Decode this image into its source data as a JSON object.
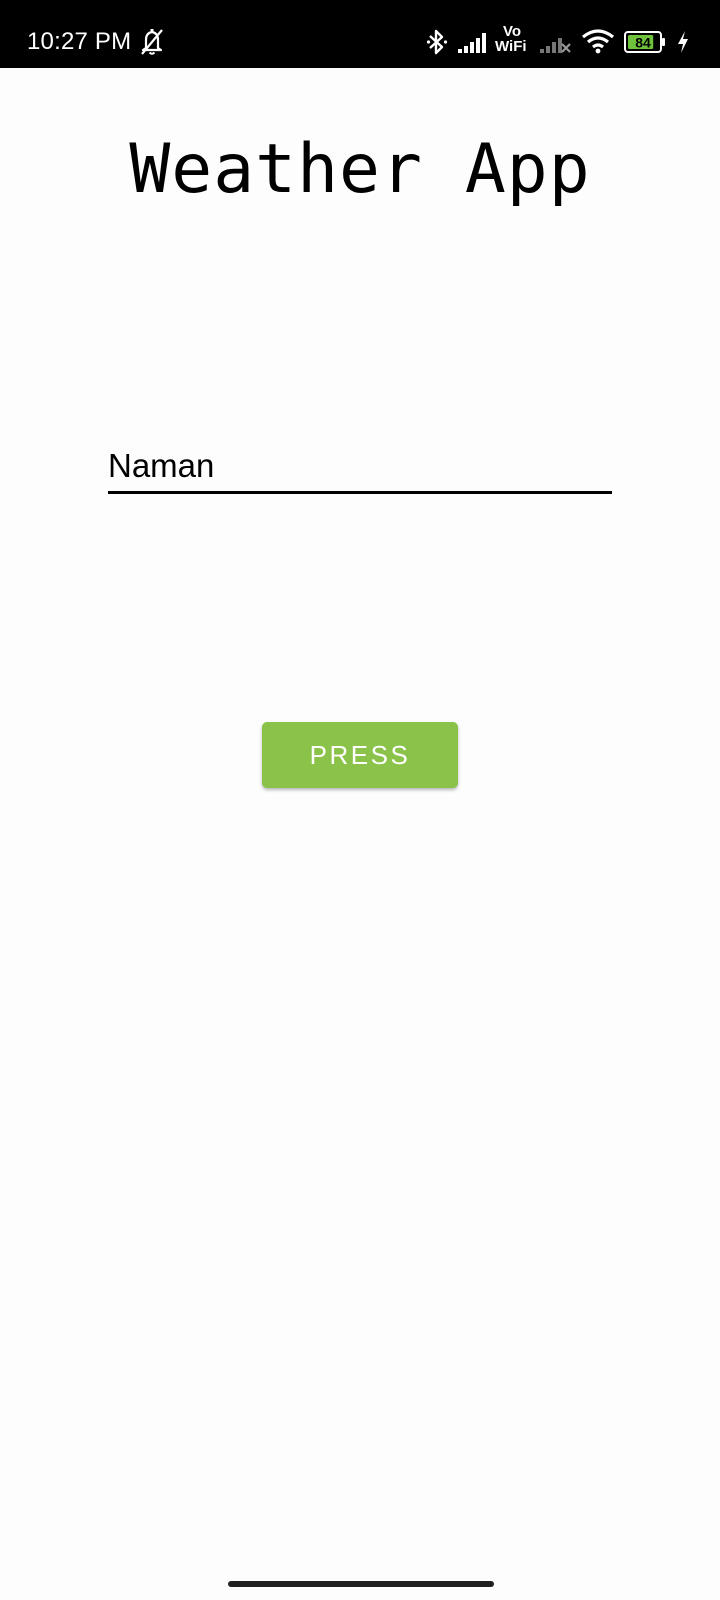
{
  "status_bar": {
    "time": "10:27 PM",
    "icons": [
      "bell-off-icon",
      "bluetooth-icon",
      "signal-icon",
      "vowifi-icon",
      "signal-off-icon",
      "wifi-icon",
      "battery-icon",
      "charging-icon"
    ],
    "vowifi_top": "Vo",
    "vowifi_bottom": "WiFi",
    "battery_level": "84",
    "battery_fill": 0.84,
    "battery_color": "#6fc23b"
  },
  "app": {
    "title": "Weather App",
    "name_input_value": "Naman",
    "button_label": "PRESS",
    "button_color": "#8bc34a"
  }
}
